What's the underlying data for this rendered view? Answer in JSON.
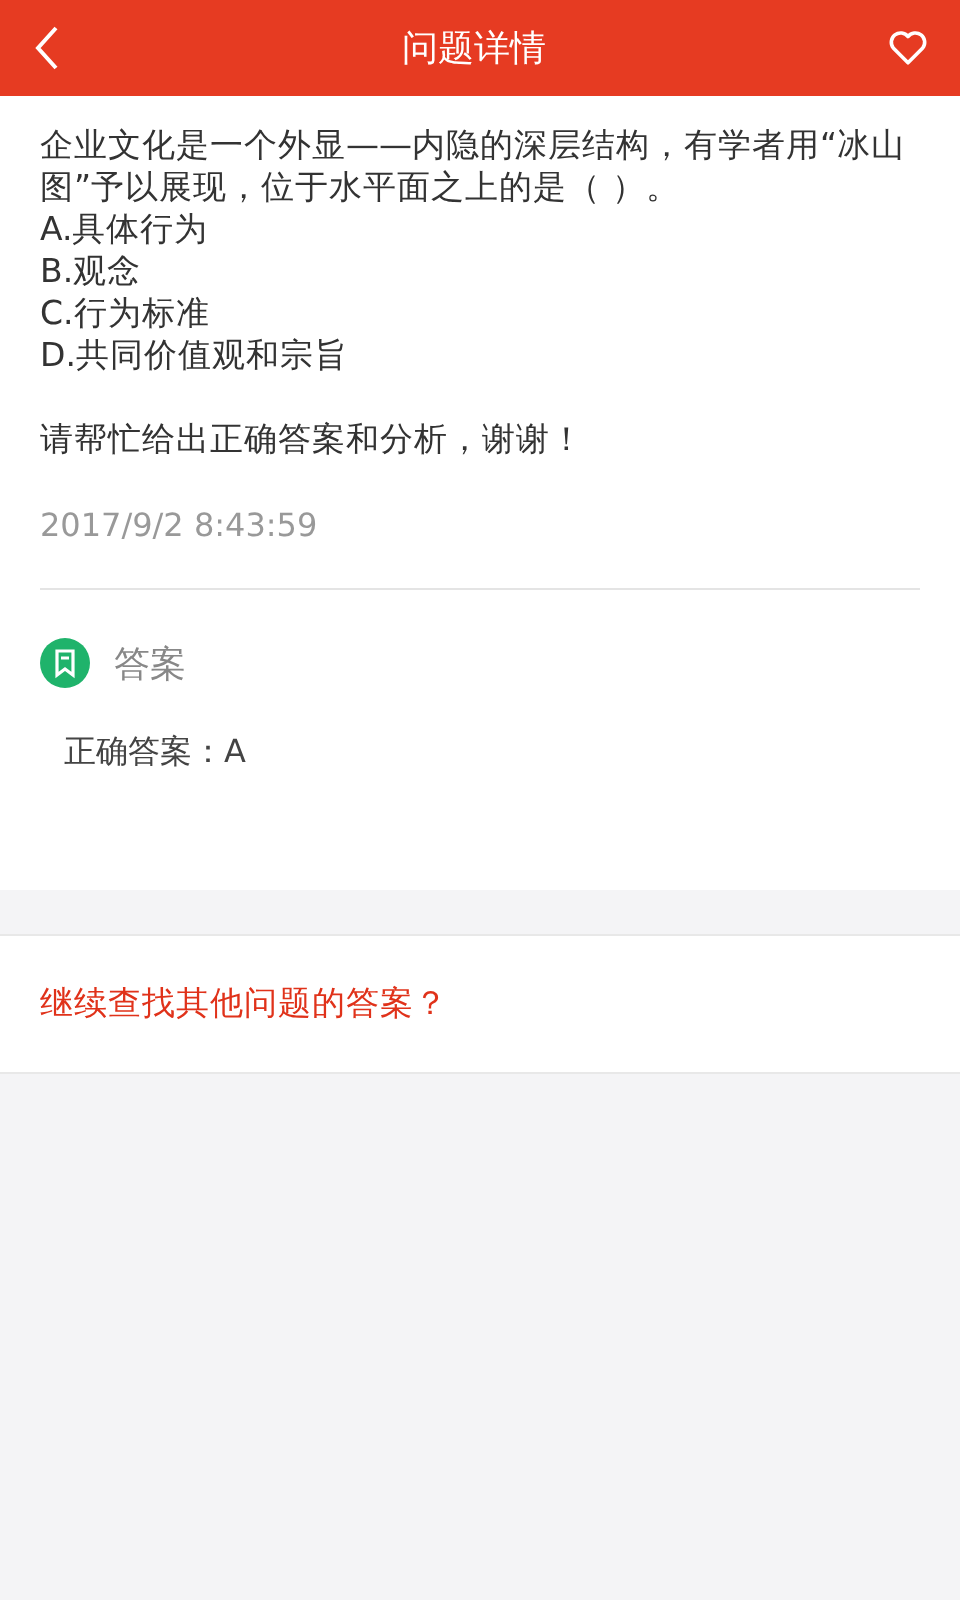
{
  "header": {
    "title": "问题详情"
  },
  "question": {
    "text": "企业文化是一个外显——内隐的深层结构，有学者用“冰山图”予以展现，位于水平面之上的是（ ）。",
    "options": [
      "A.具体行为",
      "B.观念",
      "C.行为标准",
      "D.共同价值观和宗旨"
    ],
    "request": "请帮忙给出正确答案和分析，谢谢！",
    "time": "2017/9/2 8:43:59"
  },
  "answer": {
    "heading": "答案",
    "text": "正确答案：A"
  },
  "more_link": "继续查找其他问题的答案？"
}
